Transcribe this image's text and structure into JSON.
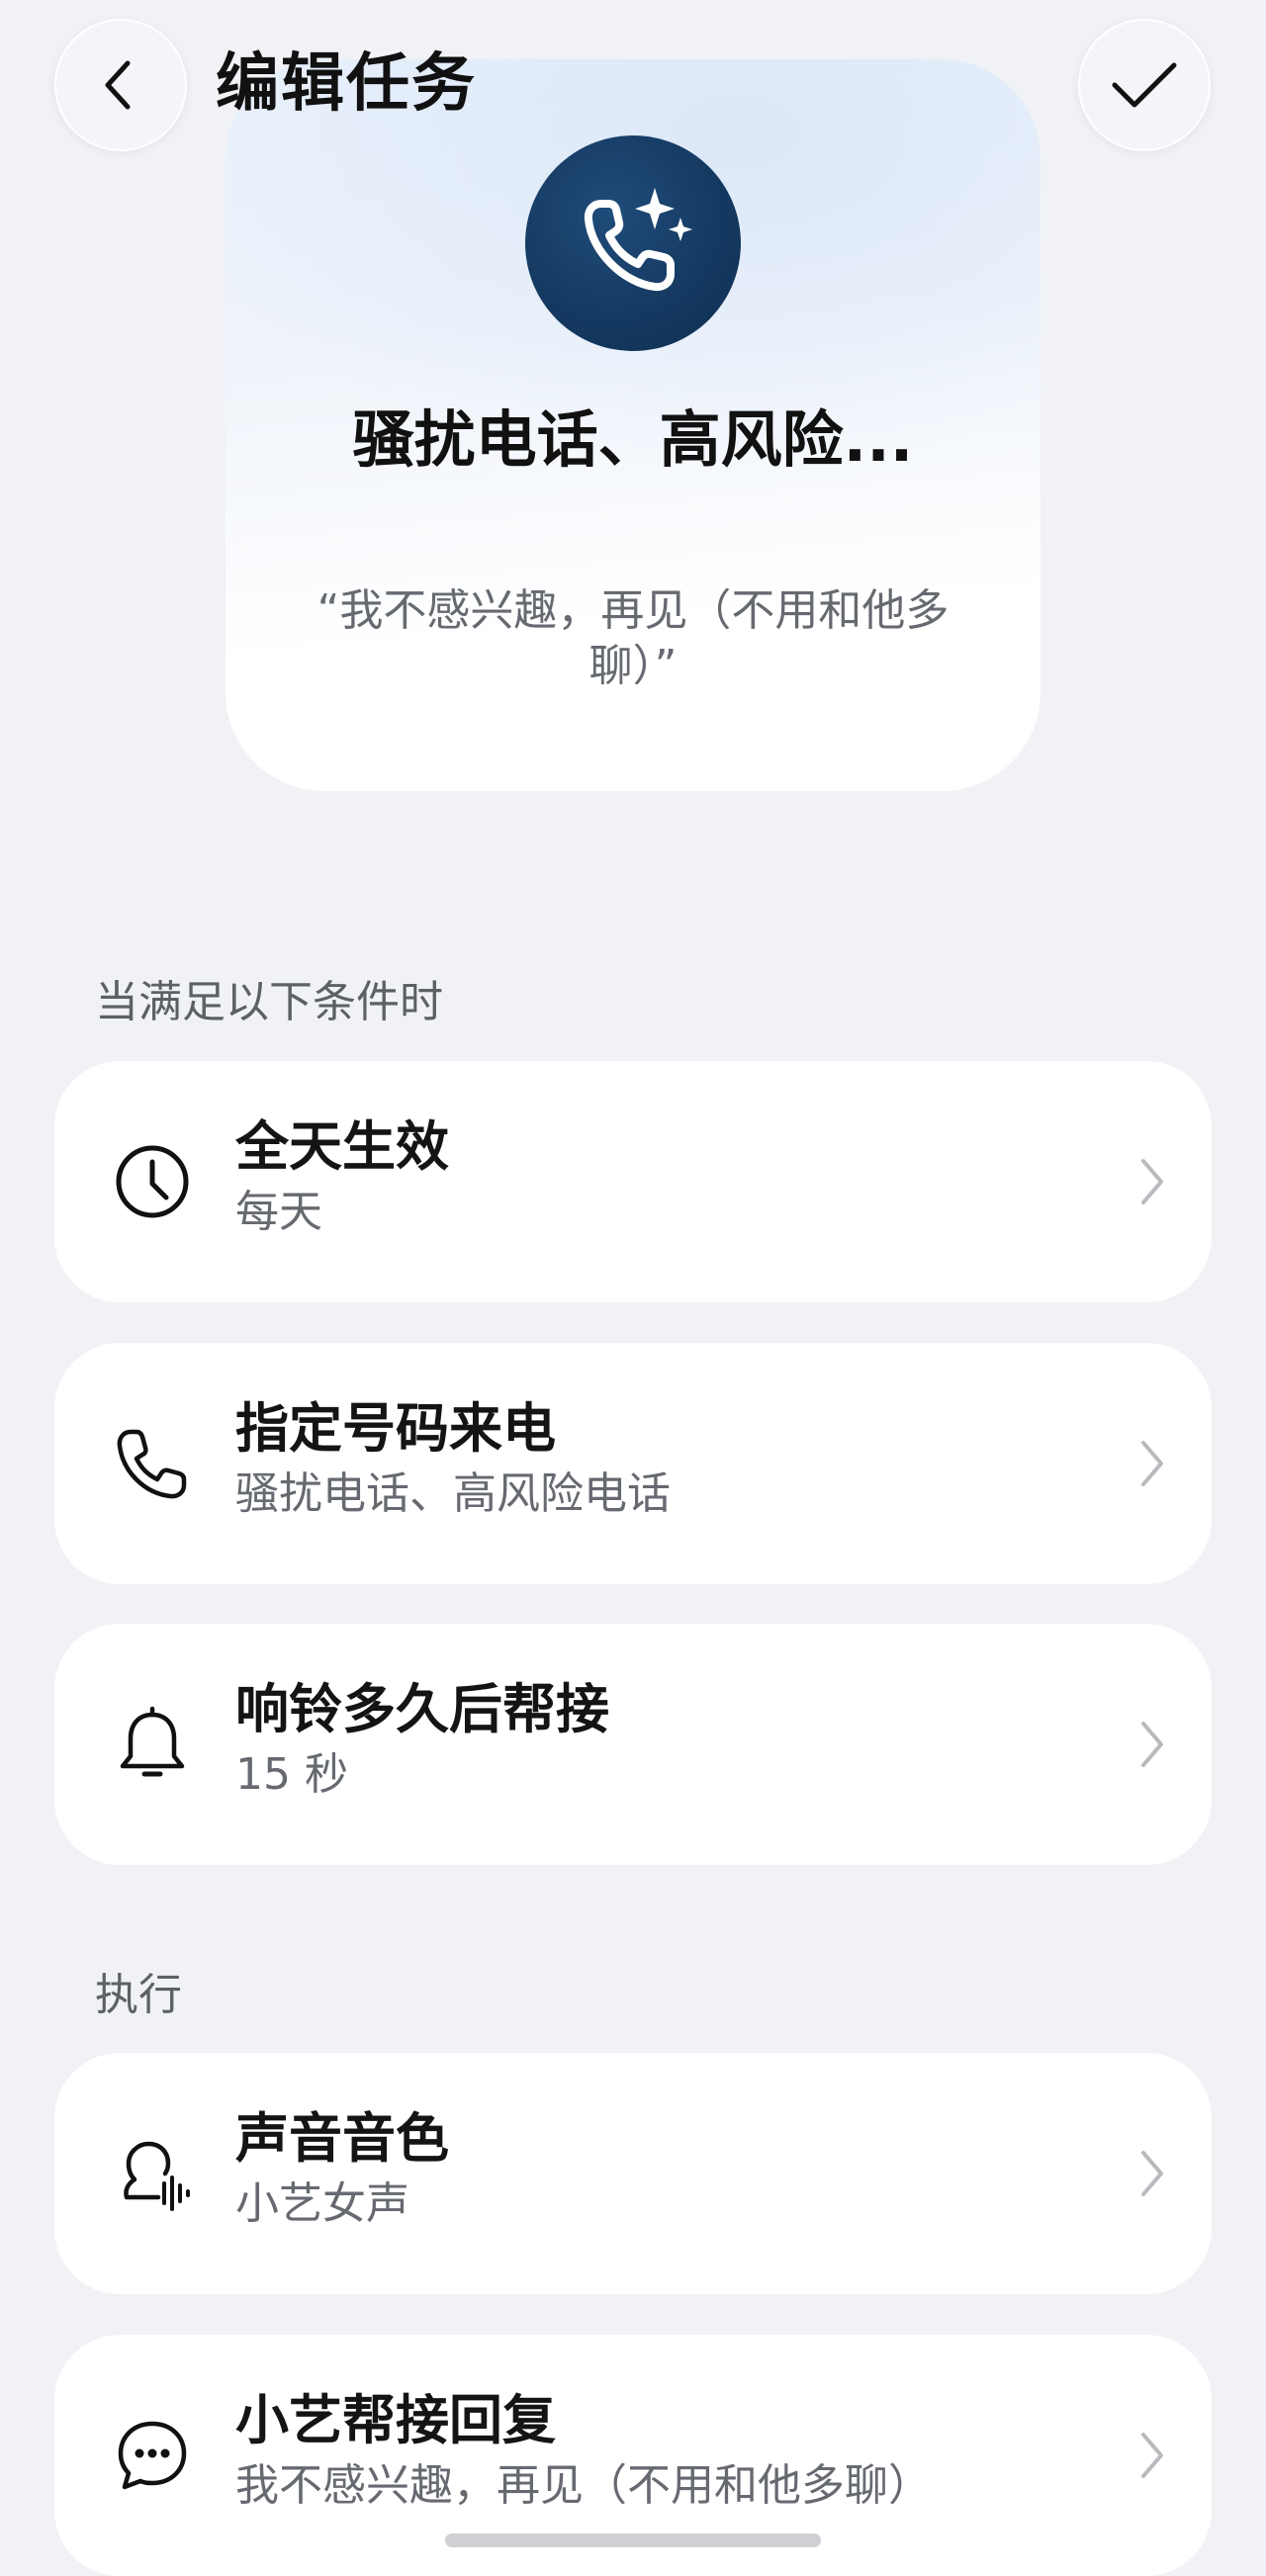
{
  "header": {
    "title": "编辑任务"
  },
  "hero": {
    "title": "骚扰电话、高风险...",
    "quote": "“我不感兴趣，再见（不用和他多聊）”"
  },
  "conditions": {
    "label": "当满足以下条件时",
    "items": [
      {
        "title": "全天生效",
        "subtitle": "每天",
        "icon": "clock-icon"
      },
      {
        "title": "指定号码来电",
        "subtitle": "骚扰电话、高风险电话",
        "icon": "phone-icon"
      },
      {
        "title": "响铃多久后帮接",
        "subtitle": "15 秒",
        "icon": "bell-icon"
      }
    ]
  },
  "actions": {
    "label": "执行",
    "items": [
      {
        "title": "声音音色",
        "subtitle": "小艺女声",
        "icon": "voice-icon"
      },
      {
        "title": "小艺帮接回复",
        "subtitle": "我不感兴趣，再见（不用和他多聊）",
        "icon": "chat-bubble-icon"
      }
    ]
  },
  "colors": {
    "background": "#f1f2f5",
    "card": "#ffffff",
    "hero_icon": "#153a62"
  }
}
